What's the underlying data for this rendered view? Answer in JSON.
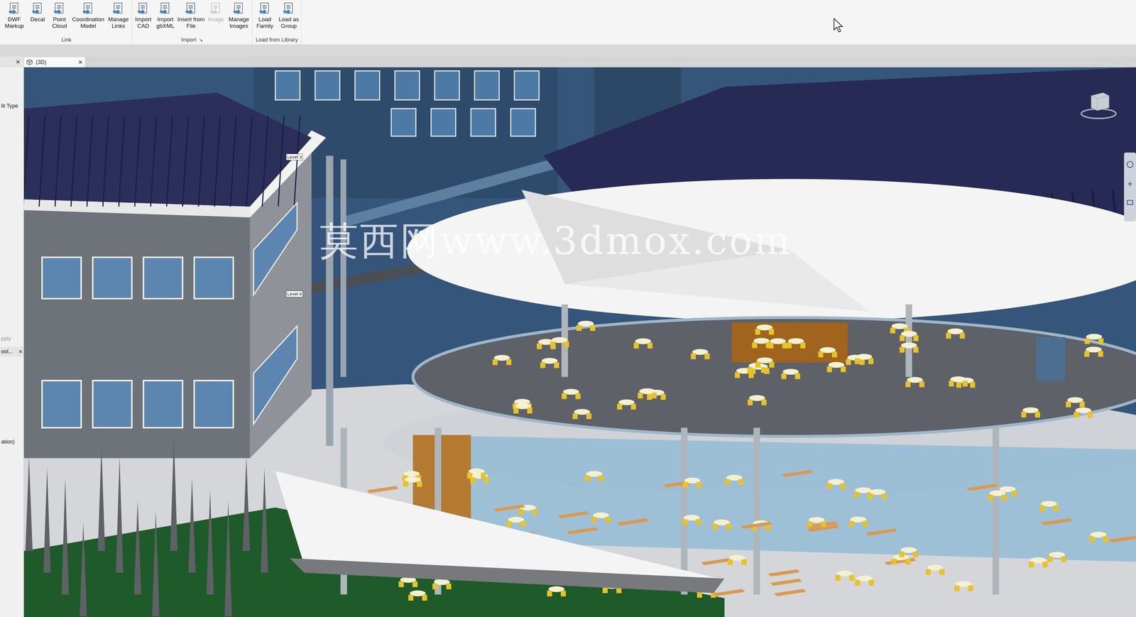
{
  "ribbon": {
    "groups": [
      {
        "label": "Link",
        "launcher": "",
        "buttons": [
          {
            "label": "DWF Markup",
            "disabled": false
          },
          {
            "label": "Decal",
            "disabled": false
          },
          {
            "label": "Point Cloud",
            "disabled": false
          },
          {
            "label": "Coordination Model",
            "disabled": false
          },
          {
            "label": "Manage Links",
            "disabled": false
          }
        ]
      },
      {
        "label": "Import",
        "launcher": "↘",
        "buttons": [
          {
            "label": "Import CAD",
            "disabled": false
          },
          {
            "label": "Import gbXML",
            "disabled": false
          },
          {
            "label": "Insert from File",
            "disabled": false
          },
          {
            "label": "Image",
            "disabled": true
          },
          {
            "label": "Manage Images",
            "disabled": false
          }
        ]
      },
      {
        "label": "Load from Library",
        "launcher": "",
        "buttons": [
          {
            "label": "Load Family",
            "disabled": false
          },
          {
            "label": "Load as Group",
            "disabled": false
          }
        ]
      }
    ]
  },
  "left_panel": {
    "close": "×",
    "type_label": "lit Type",
    "apply": "pply",
    "browser": "ool...",
    "browser_close": "×",
    "note": "ation)"
  },
  "view_tab": {
    "label": "(3D)",
    "close": "×",
    "selected": true
  },
  "viewport": {
    "level_tags": [
      "Level 3",
      "Level 4"
    ],
    "watermark": "莫西网www.3dmox.com"
  }
}
